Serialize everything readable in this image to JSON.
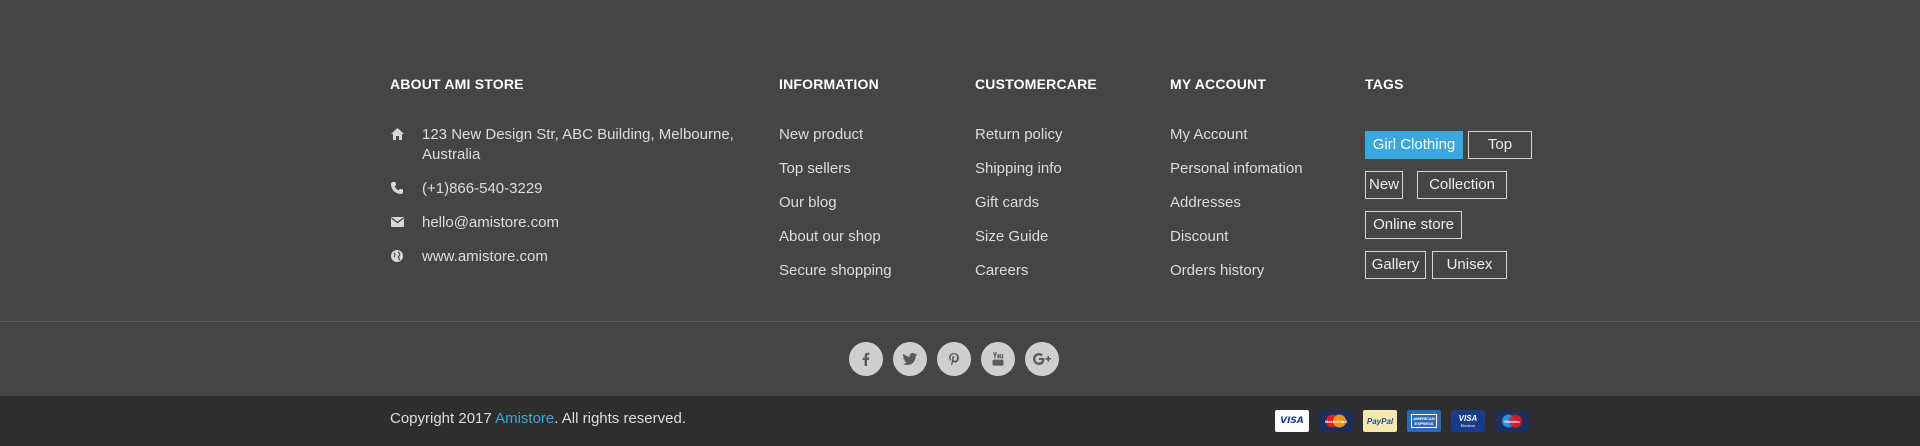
{
  "about": {
    "title": "ABOUT AMI STORE",
    "address_line1": "123 New Design Str, ABC Building, Melbourne,",
    "address_line2": "Australia",
    "phone": "(+1)866-540-3229",
    "email": "hello@amistore.com",
    "website": "www.amistore.com"
  },
  "information": {
    "title": "INFORMATION",
    "links": [
      "New product",
      "Top sellers",
      "Our blog",
      "About our shop",
      "Secure shopping"
    ]
  },
  "customercare": {
    "title": "CUSTOMERCARE",
    "links": [
      "Return policy",
      "Shipping info",
      "Gift cards",
      "Size Guide",
      "Careers"
    ]
  },
  "my_account": {
    "title": "MY ACCOUNT",
    "links": [
      "My Account",
      "Personal infomation",
      "Addresses",
      "Discount",
      "Orders history"
    ]
  },
  "tags": {
    "title": "TAGS",
    "items": [
      "Girl Clothing",
      "Top",
      "New",
      "Collection",
      "Online store",
      "Gallery",
      "Unisex"
    ],
    "active": "Girl Clothing",
    "accent_color": "#3aa7de"
  },
  "social": [
    "facebook-icon",
    "twitter-icon",
    "pinterest-icon",
    "youtube-icon",
    "google-plus-icon"
  ],
  "copyright": {
    "prefix": "Copyright 2017 ",
    "brand": "Amistore",
    "suffix": ". All rights reserved."
  },
  "payments": {
    "visa": "VISA",
    "mastercard": "MasterCard",
    "paypal": "PayPal",
    "amex": "AMERICAN EXPRESS",
    "visa_electron_brand": "VISA",
    "visa_electron_sub": "Electron",
    "maestro": "Maestro"
  }
}
